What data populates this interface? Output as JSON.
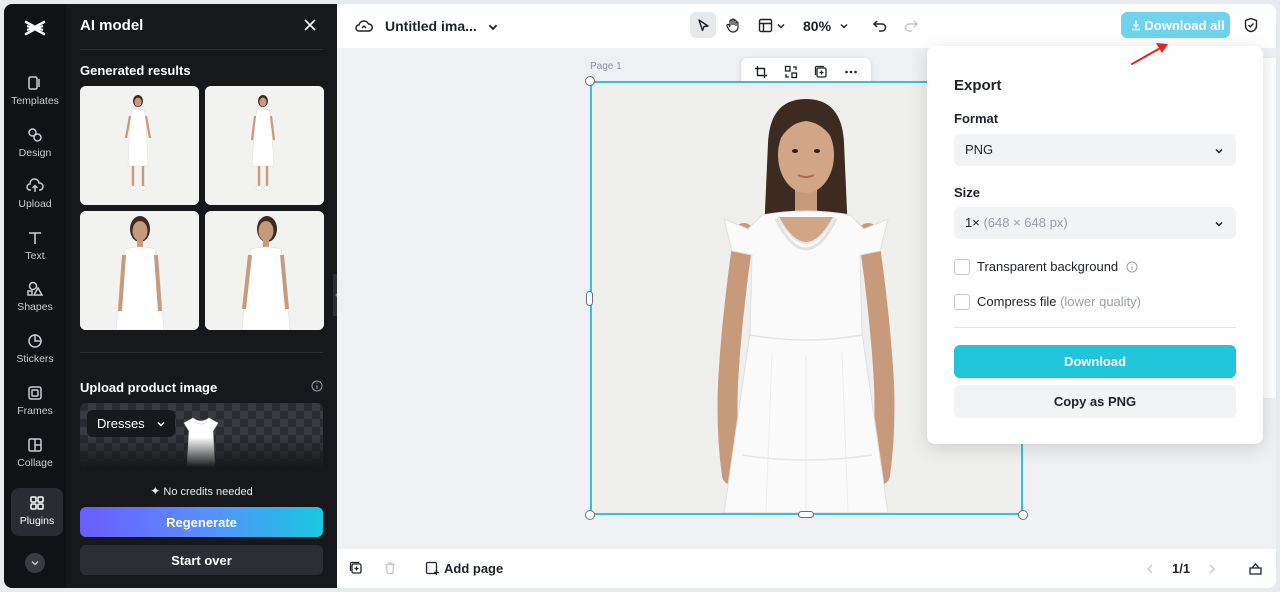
{
  "rail": {
    "items": [
      {
        "label": "Templates",
        "icon": "templates-icon"
      },
      {
        "label": "Design",
        "icon": "design-icon"
      },
      {
        "label": "Upload",
        "icon": "upload-icon"
      },
      {
        "label": "Text",
        "icon": "text-icon"
      },
      {
        "label": "Shapes",
        "icon": "shapes-icon"
      },
      {
        "label": "Stickers",
        "icon": "stickers-icon"
      },
      {
        "label": "Frames",
        "icon": "frames-icon"
      },
      {
        "label": "Collage",
        "icon": "collage-icon"
      },
      {
        "label": "Plugins",
        "icon": "plugins-icon",
        "active": true
      }
    ]
  },
  "panel": {
    "title": "AI model",
    "generated_heading": "Generated results",
    "upload_heading": "Upload product image",
    "category": "Dresses",
    "credits": "No credits needed",
    "regenerate_label": "Regenerate",
    "start_over_label": "Start over"
  },
  "topbar": {
    "doc_title": "Untitled ima...",
    "zoom": "80%",
    "download_all_label": "Download all"
  },
  "canvas": {
    "page_label": "Page 1"
  },
  "bottombar": {
    "add_page_label": "Add page",
    "page_indicator": "1/1"
  },
  "export": {
    "title": "Export",
    "format_label": "Format",
    "format_value": "PNG",
    "size_label": "Size",
    "size_value": "1×",
    "size_detail": "(648 × 648 px)",
    "transparent_label": "Transparent background",
    "compress_label": "Compress file",
    "compress_detail": "(lower quality)",
    "download_label": "Download",
    "copy_label": "Copy as PNG"
  },
  "colors": {
    "accent": "#21c5da",
    "download_all_bg": "#6fd3ec",
    "selection": "#35c2d9",
    "annotation_arrow": "#e0242b"
  }
}
